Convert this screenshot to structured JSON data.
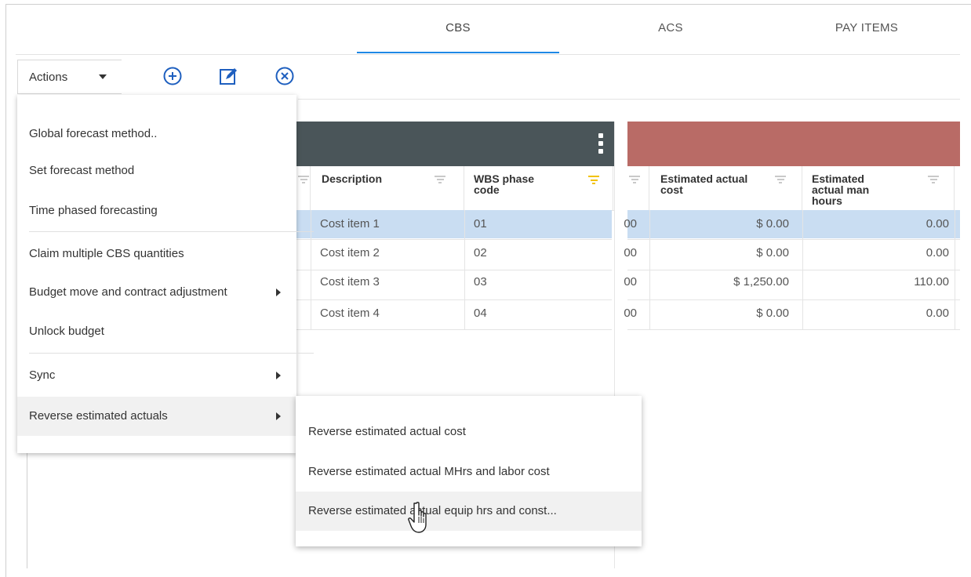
{
  "tabs": [
    {
      "label": "CBS",
      "active": true
    },
    {
      "label": "ACS",
      "active": false
    },
    {
      "label": "PAY ITEMS",
      "active": false
    }
  ],
  "toolbar": {
    "actions_label": "Actions",
    "icons": [
      "add-circle-icon",
      "edit-icon",
      "cancel-circle-icon"
    ]
  },
  "grid": {
    "columns": {
      "description": "Description",
      "wbs_phase_code": "WBS phase code",
      "estimated_actual_cost": "Estimated actual cost",
      "estimated_actual_man_hours": "Estimated actual man hours"
    },
    "rows": [
      {
        "description": "Cost item 1",
        "wbs": "01",
        "partial": "00",
        "cost": "$ 0.00",
        "hours": "0.00",
        "selected": true
      },
      {
        "description": "Cost item 2",
        "wbs": "02",
        "partial": "00",
        "cost": "$ 0.00",
        "hours": "0.00",
        "selected": false
      },
      {
        "description": "Cost item 3",
        "wbs": "03",
        "partial": "00",
        "cost": "$ 1,250.00",
        "hours": "110.00",
        "selected": false
      },
      {
        "description": "Cost item 4",
        "wbs": "04",
        "partial": "00",
        "cost": "$ 0.00",
        "hours": "0.00",
        "selected": false
      }
    ],
    "band_colors": {
      "left": "#4a5559",
      "right": "#b96b66",
      "selected_row": "#c9ddf2"
    }
  },
  "actions_menu": {
    "items": [
      {
        "label": "Global forecast method..",
        "submenu": false
      },
      {
        "label": "Set forecast method",
        "submenu": false
      },
      {
        "label": "Time phased forecasting",
        "submenu": false
      },
      {
        "label": "Claim multiple CBS quantities",
        "submenu": false
      },
      {
        "label": "Budget move and contract adjustment",
        "submenu": true
      },
      {
        "label": "Unlock budget",
        "submenu": false
      },
      {
        "label": "Sync",
        "submenu": true
      },
      {
        "label": "Reverse estimated actuals",
        "submenu": true,
        "highlighted": true
      }
    ]
  },
  "reverse_submenu": {
    "items": [
      {
        "label": "Reverse estimated actual cost"
      },
      {
        "label": "Reverse estimated actual MHrs and labor cost"
      },
      {
        "label": "Reverse estimated actual equip hrs and const...",
        "highlighted": true
      }
    ]
  }
}
